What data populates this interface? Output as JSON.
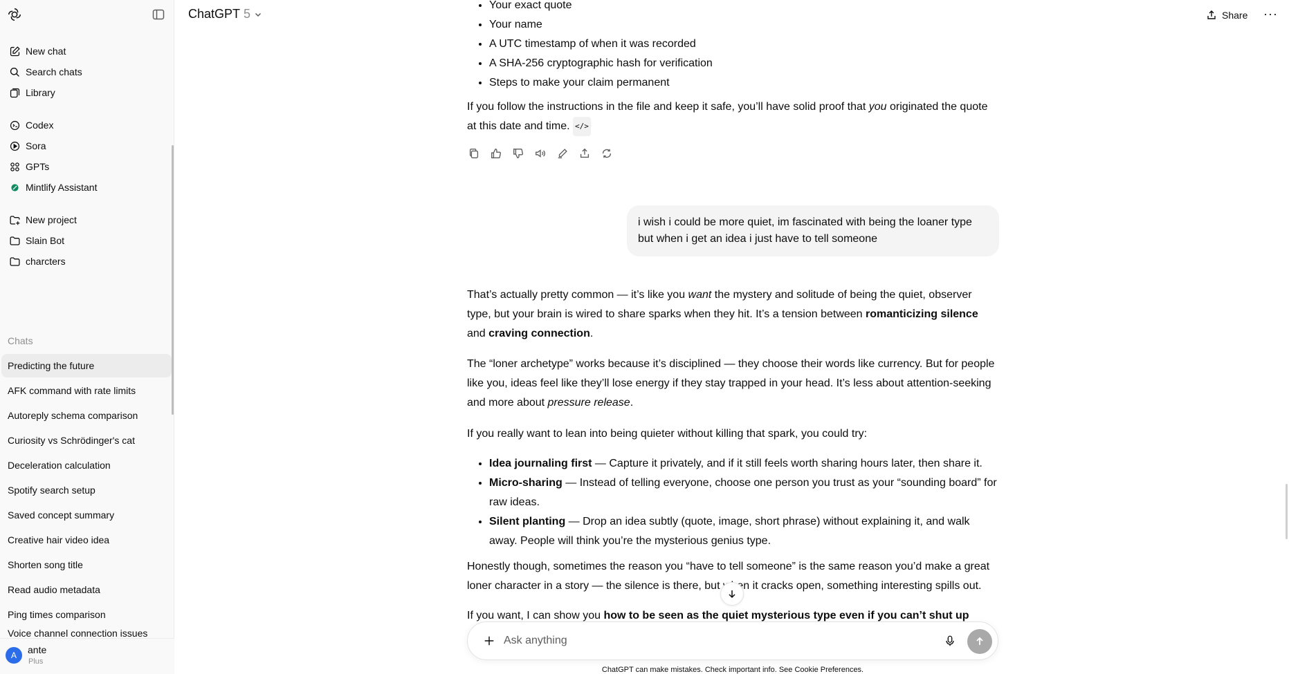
{
  "sidebar": {
    "nav": [
      {
        "label": "New chat",
        "icon": "new-chat-icon"
      },
      {
        "label": "Search chats",
        "icon": "search-icon"
      },
      {
        "label": "Library",
        "icon": "library-icon"
      }
    ],
    "apps": [
      {
        "label": "Codex",
        "icon": "codex-icon"
      },
      {
        "label": "Sora",
        "icon": "sora-icon"
      },
      {
        "label": "GPTs",
        "icon": "gpts-icon"
      },
      {
        "label": "Mintlify Assistant",
        "icon": "mintlify-icon"
      }
    ],
    "projects": [
      {
        "label": "New project",
        "icon": "new-project-icon"
      },
      {
        "label": "Slain Bot",
        "icon": "folder-icon"
      },
      {
        "label": "charcters",
        "icon": "folder-icon"
      }
    ],
    "chats_label": "Chats",
    "chats": [
      "Predicting the future",
      "AFK command with rate limits",
      "Autoreply schema comparison",
      "Curiosity vs Schrödinger's cat",
      "Deceleration calculation",
      "Spotify search setup",
      "Saved concept summary",
      "Creative hair video idea",
      "Shorten song title",
      "Read audio metadata",
      "Ping times comparison",
      "Voice channel connection issues"
    ],
    "user": {
      "initial": "A",
      "name": "ante",
      "plan": "Plus"
    }
  },
  "header": {
    "model_name": "ChatGPT",
    "model_version": "5",
    "share_label": "Share",
    "more_label": "···"
  },
  "conversation": {
    "prev_bullets": [
      "Your exact quote",
      "Your name",
      "A UTC timestamp of when it was recorded",
      "A SHA-256 cryptographic hash for verification",
      "Steps to make your claim permanent"
    ],
    "prev_para": {
      "a": "If you follow the instructions in the file and keep it safe, you’ll have solid proof that ",
      "b": "you",
      "c": " originated the quote at this date and time. ",
      "code": "</>"
    },
    "user_message": "i wish i could be more quiet, im fascinated with being the loaner type but when i get an idea i just have to tell someone",
    "p1": {
      "a": "That’s actually pretty common — it’s like you ",
      "b": "want",
      "c": " the mystery and solitude of being the quiet, observer type, but your brain is wired to share sparks when they hit. It’s a tension between ",
      "d": "romanticizing silence",
      "e": " and ",
      "f": "craving connection",
      "g": "."
    },
    "p2": {
      "a": "The “loner archetype” works because it’s disciplined — they choose their words like currency. But for people like you, ideas feel like they’ll lose energy if they stay trapped in your head. It’s less about attention-seeking and more about ",
      "b": "pressure release",
      "c": "."
    },
    "p3": "If you really want to lean into being quieter without killing that spark, you could try:",
    "tips": [
      {
        "title": "Idea journaling first",
        "text": " — Capture it privately, and if it still feels worth sharing hours later, then share it."
      },
      {
        "title": "Micro-sharing",
        "text": " — Instead of telling everyone, choose one person you trust as your “sounding board” for raw ideas."
      },
      {
        "title": "Silent planting",
        "text": " — Drop an idea subtly (quote, image, short phrase) without explaining it, and walk away. People will think you’re the mysterious genius type."
      }
    ],
    "p4": "Honestly though, sometimes the reason you “have to tell someone” is the same reason you’d make a great loner character in a story — the silence is there, but when it cracks open, something interesting spills out.",
    "p5": {
      "a": "If you want, I can show you ",
      "b": "how to be seen as the quiet mysterious type even if you can’t shut up"
    }
  },
  "composer": {
    "placeholder": "Ask anything",
    "disclaimer": "ChatGPT can make mistakes. Check important info. See Cookie Preferences."
  }
}
